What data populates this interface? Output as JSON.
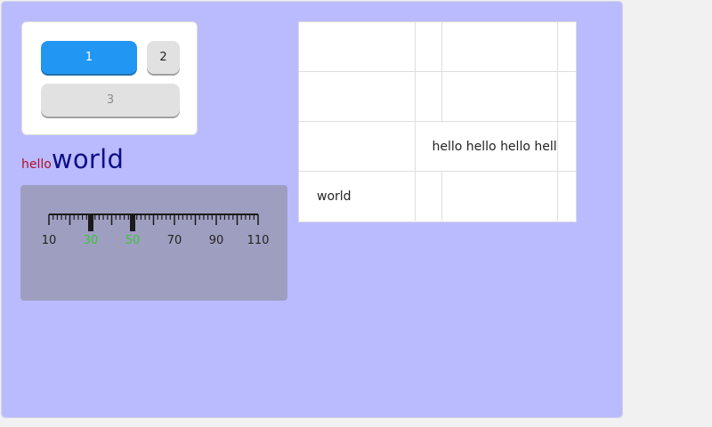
{
  "buttons": {
    "b1": "1",
    "b2": "2",
    "b3": "3"
  },
  "label": {
    "small": "hello",
    "big": "world"
  },
  "ruler": {
    "min": 10,
    "max": 110,
    "minor_step": 2,
    "major_step": 10,
    "labels": [
      "10",
      "30",
      "50",
      "70",
      "90",
      "110"
    ],
    "highlighted": [
      "30",
      "50"
    ],
    "highlight_color": "#3cc43c"
  },
  "table": {
    "rows": [
      [
        "",
        "",
        "",
        ""
      ],
      [
        "",
        "",
        "",
        ""
      ],
      [
        "",
        "hello hello hello hello",
        ""
      ],
      [
        "world",
        "",
        "",
        ""
      ]
    ]
  },
  "colors": {
    "app_background": "#babbff",
    "primary_button": "#2196f3",
    "small_label": "#b0102a",
    "big_label": "#0f0f88"
  }
}
